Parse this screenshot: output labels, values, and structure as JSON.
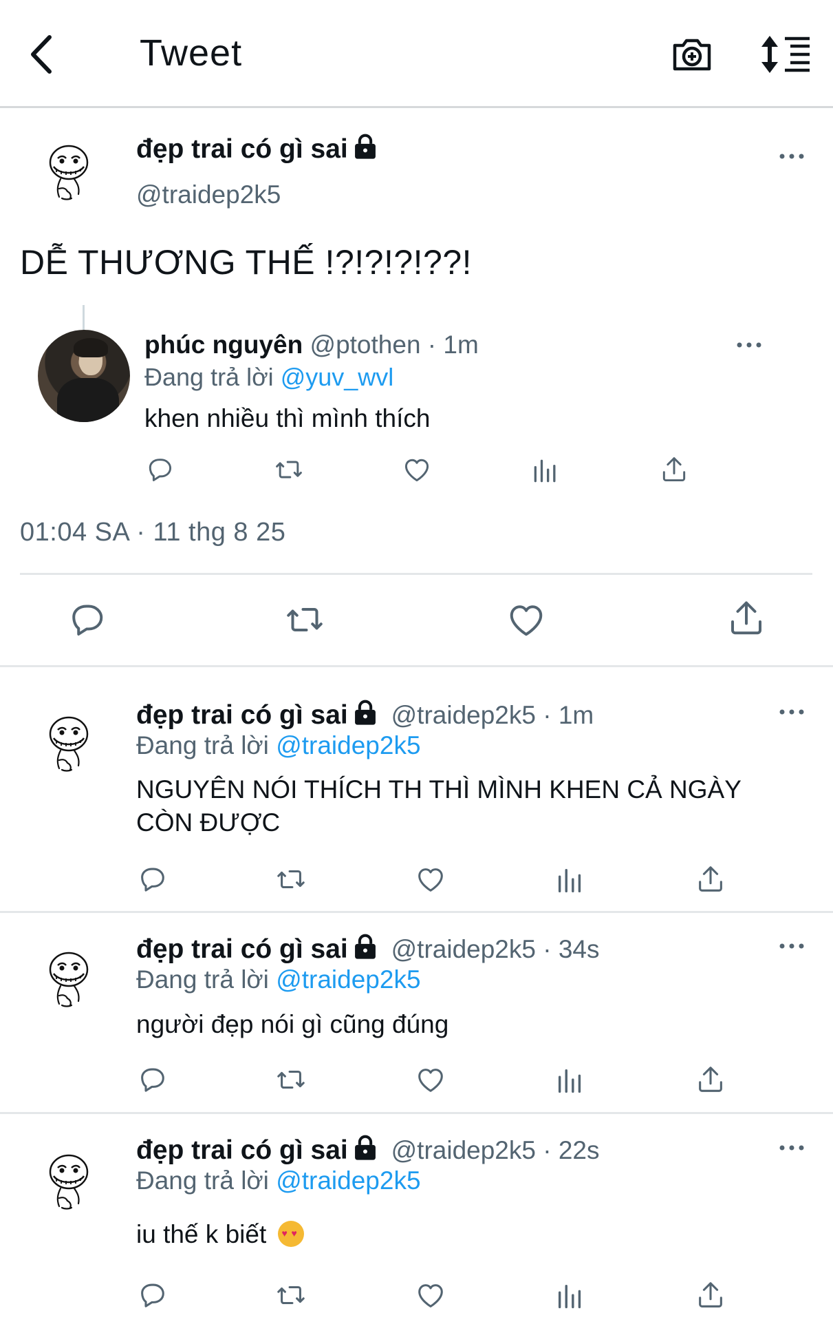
{
  "header": {
    "title": "Tweet"
  },
  "main_tweet": {
    "display_name": "đẹp trai có gì sai",
    "handle": "@traidep2k5",
    "text": "DỄ THƯƠNG THẾ !?!?!?!??!",
    "timestamp": "01:04 SA · 11 thg 8 25"
  },
  "quoted_reply": {
    "display_name": "phúc nguyên",
    "handle_time": "@ptothen · 1m",
    "replying_prefix": "Đang trả lời",
    "replying_to": "@yuv_wvl",
    "text": "khen nhiều thì mình thích"
  },
  "replies": [
    {
      "display_name": "đẹp trai có gì sai",
      "handle_time": "@traidep2k5 · 1m",
      "replying_prefix": "Đang trả lời",
      "replying_to": "@traidep2k5",
      "text_line1": "NGUYÊN NÓI THÍCH TH THÌ MÌNH KHEN CẢ NGÀY",
      "text_line2": "CÒN ĐƯỢC"
    },
    {
      "display_name": "đẹp trai có gì sai",
      "handle_time": "@traidep2k5 · 34s",
      "replying_prefix": "Đang trả lời",
      "replying_to": "@traidep2k5",
      "text_line1": "người đẹp nói gì cũng đúng"
    },
    {
      "display_name": "đẹp trai có gì sai",
      "handle_time": "@traidep2k5 · 22s",
      "replying_prefix": "Đang trả lời",
      "replying_to": "@traidep2k5",
      "text_line1": "iu thế k biết",
      "emoji": "😻"
    }
  ],
  "colors": {
    "link": "#1d9bf0",
    "secondary": "#536471",
    "primary": "#0f1419"
  },
  "icons": [
    "back-arrow-icon",
    "camera-plus-icon",
    "sort-icon",
    "lock-icon",
    "more-icon",
    "reply-icon",
    "retweet-icon",
    "like-icon",
    "views-icon",
    "share-icon"
  ]
}
